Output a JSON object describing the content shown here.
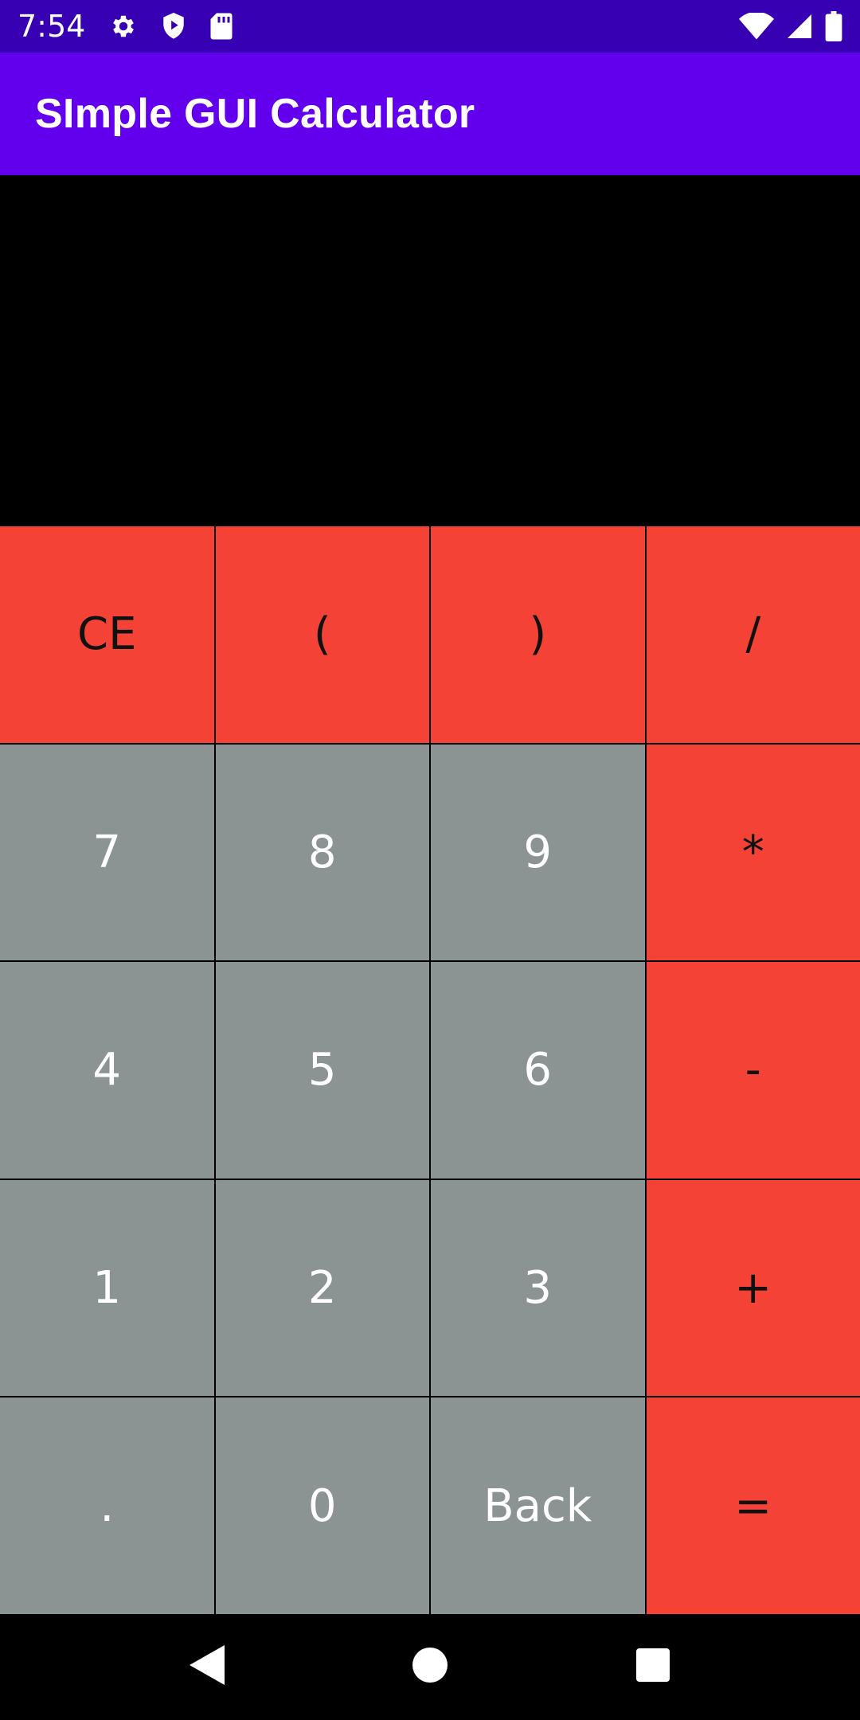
{
  "status_bar": {
    "time": "7:54",
    "left_icons": [
      "gear-icon",
      "shield-play-icon",
      "sd-card-icon"
    ],
    "right_icons": [
      "wifi-icon",
      "signal-icon",
      "battery-icon"
    ]
  },
  "app_bar": {
    "title": "SImple GUI Calculator"
  },
  "display": {
    "value": ""
  },
  "keypad": {
    "keys": [
      {
        "label": "CE",
        "type": "op"
      },
      {
        "label": "(",
        "type": "op"
      },
      {
        "label": ")",
        "type": "op"
      },
      {
        "label": "/",
        "type": "op"
      },
      {
        "label": "7",
        "type": "num"
      },
      {
        "label": "8",
        "type": "num"
      },
      {
        "label": "9",
        "type": "num"
      },
      {
        "label": "*",
        "type": "op"
      },
      {
        "label": "4",
        "type": "num"
      },
      {
        "label": "5",
        "type": "num"
      },
      {
        "label": "6",
        "type": "num"
      },
      {
        "label": "-",
        "type": "op"
      },
      {
        "label": "1",
        "type": "num"
      },
      {
        "label": "2",
        "type": "num"
      },
      {
        "label": "3",
        "type": "num"
      },
      {
        "label": "+",
        "type": "op"
      },
      {
        "label": ".",
        "type": "num"
      },
      {
        "label": "0",
        "type": "num"
      },
      {
        "label": "Back",
        "type": "num"
      },
      {
        "label": "=",
        "type": "op"
      }
    ]
  },
  "nav_bar": {
    "buttons": [
      "back-triangle-icon",
      "home-circle-icon",
      "recents-square-icon"
    ]
  },
  "colors": {
    "status_bar": "#3700b3",
    "app_bar": "#6200ee",
    "operator_key": "#f44336",
    "number_key": "#8c9393"
  }
}
